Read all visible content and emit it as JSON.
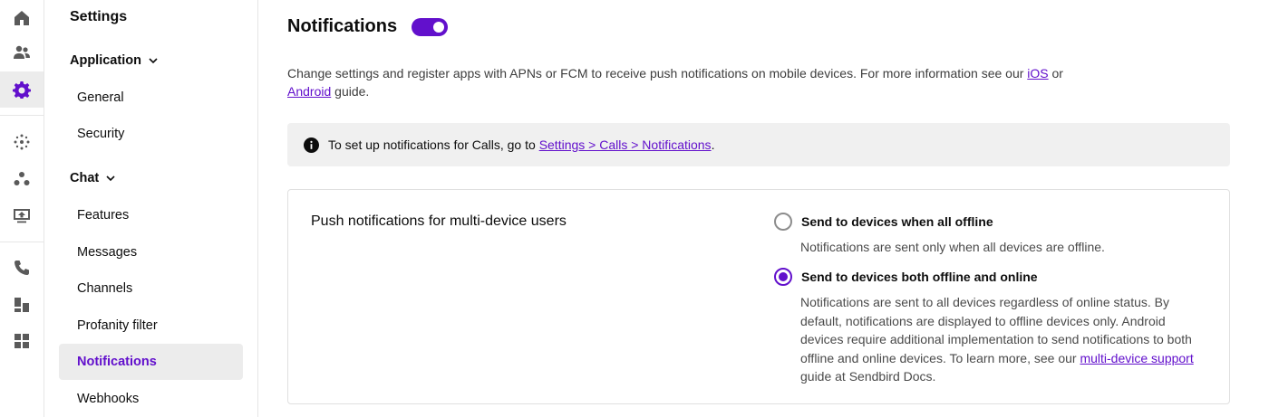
{
  "rail": {
    "icons": [
      "home-icon",
      "users-icon",
      "gear-icon",
      "sparkle-icon",
      "group-icon",
      "upload-screen-icon",
      "phone-icon",
      "desk-icon",
      "grid-icon"
    ]
  },
  "sidebar": {
    "title": "Settings",
    "groups": [
      {
        "label": "Application",
        "items": [
          "General",
          "Security"
        ]
      },
      {
        "label": "Chat",
        "items": [
          "Features",
          "Messages",
          "Channels",
          "Profanity filter",
          "Notifications",
          "Webhooks"
        ]
      }
    ],
    "active_item": "Notifications"
  },
  "main": {
    "title": "Notifications",
    "toggle_on": true,
    "description": {
      "part1": "Change settings and register apps with APNs or FCM to receive push notifications on mobile devices. For more information see our ",
      "ios_link": "iOS",
      "part2": " or",
      "android_link": "Android",
      "part3": " guide."
    },
    "info": {
      "text": "To set up notifications for Calls, go to ",
      "link": "Settings > Calls > Notifications",
      "suffix": "."
    },
    "card": {
      "title": "Push notifications for multi-device users",
      "options": [
        {
          "label": "Send to devices when all offline",
          "help": "Notifications are sent only when all devices are offline.",
          "checked": false
        },
        {
          "label": "Send to devices both offline and online",
          "help_part1": "Notifications are sent to all devices regardless of online status. By default, notifications are displayed to offline devices only. Android devices require additional implementation to send notifications to both offline and online devices. To learn more, see our ",
          "help_link": "multi-device support",
          "help_part2": " guide at Sendbird Docs.",
          "checked": true
        }
      ]
    }
  },
  "colors": {
    "accent": "#6210cc",
    "active_bg": "#ececec",
    "info_bg": "#f0f0f0"
  }
}
